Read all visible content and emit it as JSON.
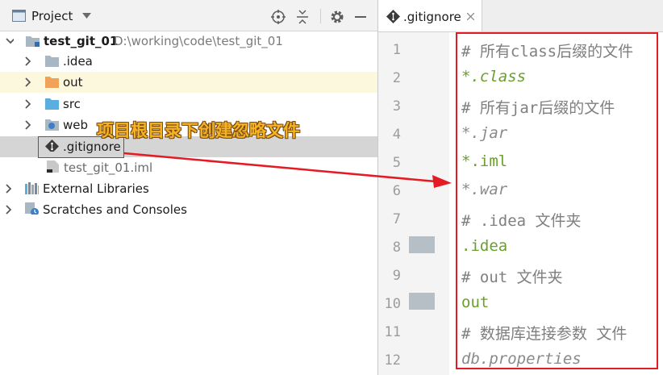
{
  "project_panel": {
    "title": "Project",
    "toolbar_icons": [
      "crosshair-icon",
      "collapse-icon",
      "gear-icon",
      "minimize-icon"
    ]
  },
  "tree": [
    {
      "label": "test_git_01",
      "path": "D:\\working\\code\\test_git_01",
      "icon": "module-folder-icon"
    },
    {
      "label": ".idea",
      "icon": "folder-icon"
    },
    {
      "label": "out",
      "icon": "excluded-folder-icon"
    },
    {
      "label": "src",
      "icon": "source-folder-icon"
    },
    {
      "label": "web",
      "icon": "web-folder-icon"
    },
    {
      "label": ".gitignore",
      "icon": "gitignore-file-icon"
    },
    {
      "label": "test_git_01.iml",
      "icon": "iml-file-icon"
    },
    {
      "label": "External Libraries",
      "icon": "libraries-icon"
    },
    {
      "label": "Scratches and Consoles",
      "icon": "scratches-icon"
    }
  ],
  "editor": {
    "tab_label": ".gitignore",
    "line_numbers": [
      "1",
      "2",
      "3",
      "4",
      "5",
      "6",
      "7",
      "8",
      "9",
      "10",
      "11",
      "12"
    ],
    "lines": [
      "# 所有class后缀的文件",
      "*.class",
      "# 所有jar后缀的文件",
      "*.jar",
      "*.iml",
      "*.war",
      "# .idea 文件夹",
      ".idea",
      "# out 文件夹",
      "out",
      "# 数据库连接参数 文件",
      "db.properties"
    ]
  },
  "annotation": {
    "text": "项目根目录下创建忽略文件",
    "color": "#f5b324",
    "highlight_color": "#e51b24"
  },
  "colors": {
    "selection": "#d5d5d5",
    "excluded_row": "#fbf8dd",
    "comment": "#7f7f7f",
    "pattern": "#6a9f2d"
  }
}
